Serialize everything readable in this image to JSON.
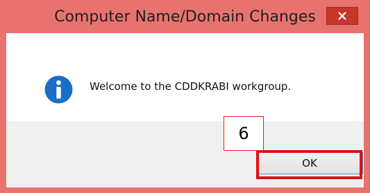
{
  "dialog": {
    "title": "Computer Name/Domain Changes",
    "message": "Welcome to the CDDKRABI workgroup.",
    "ok_label": "OK",
    "icon": "info-icon",
    "close_icon": "close-icon"
  },
  "annotation": {
    "step_number": "6",
    "highlight_color": "#e01010"
  },
  "colors": {
    "titlebar": "#e8736e",
    "close_button": "#c7352b",
    "info_icon": "#1a6fc4"
  }
}
